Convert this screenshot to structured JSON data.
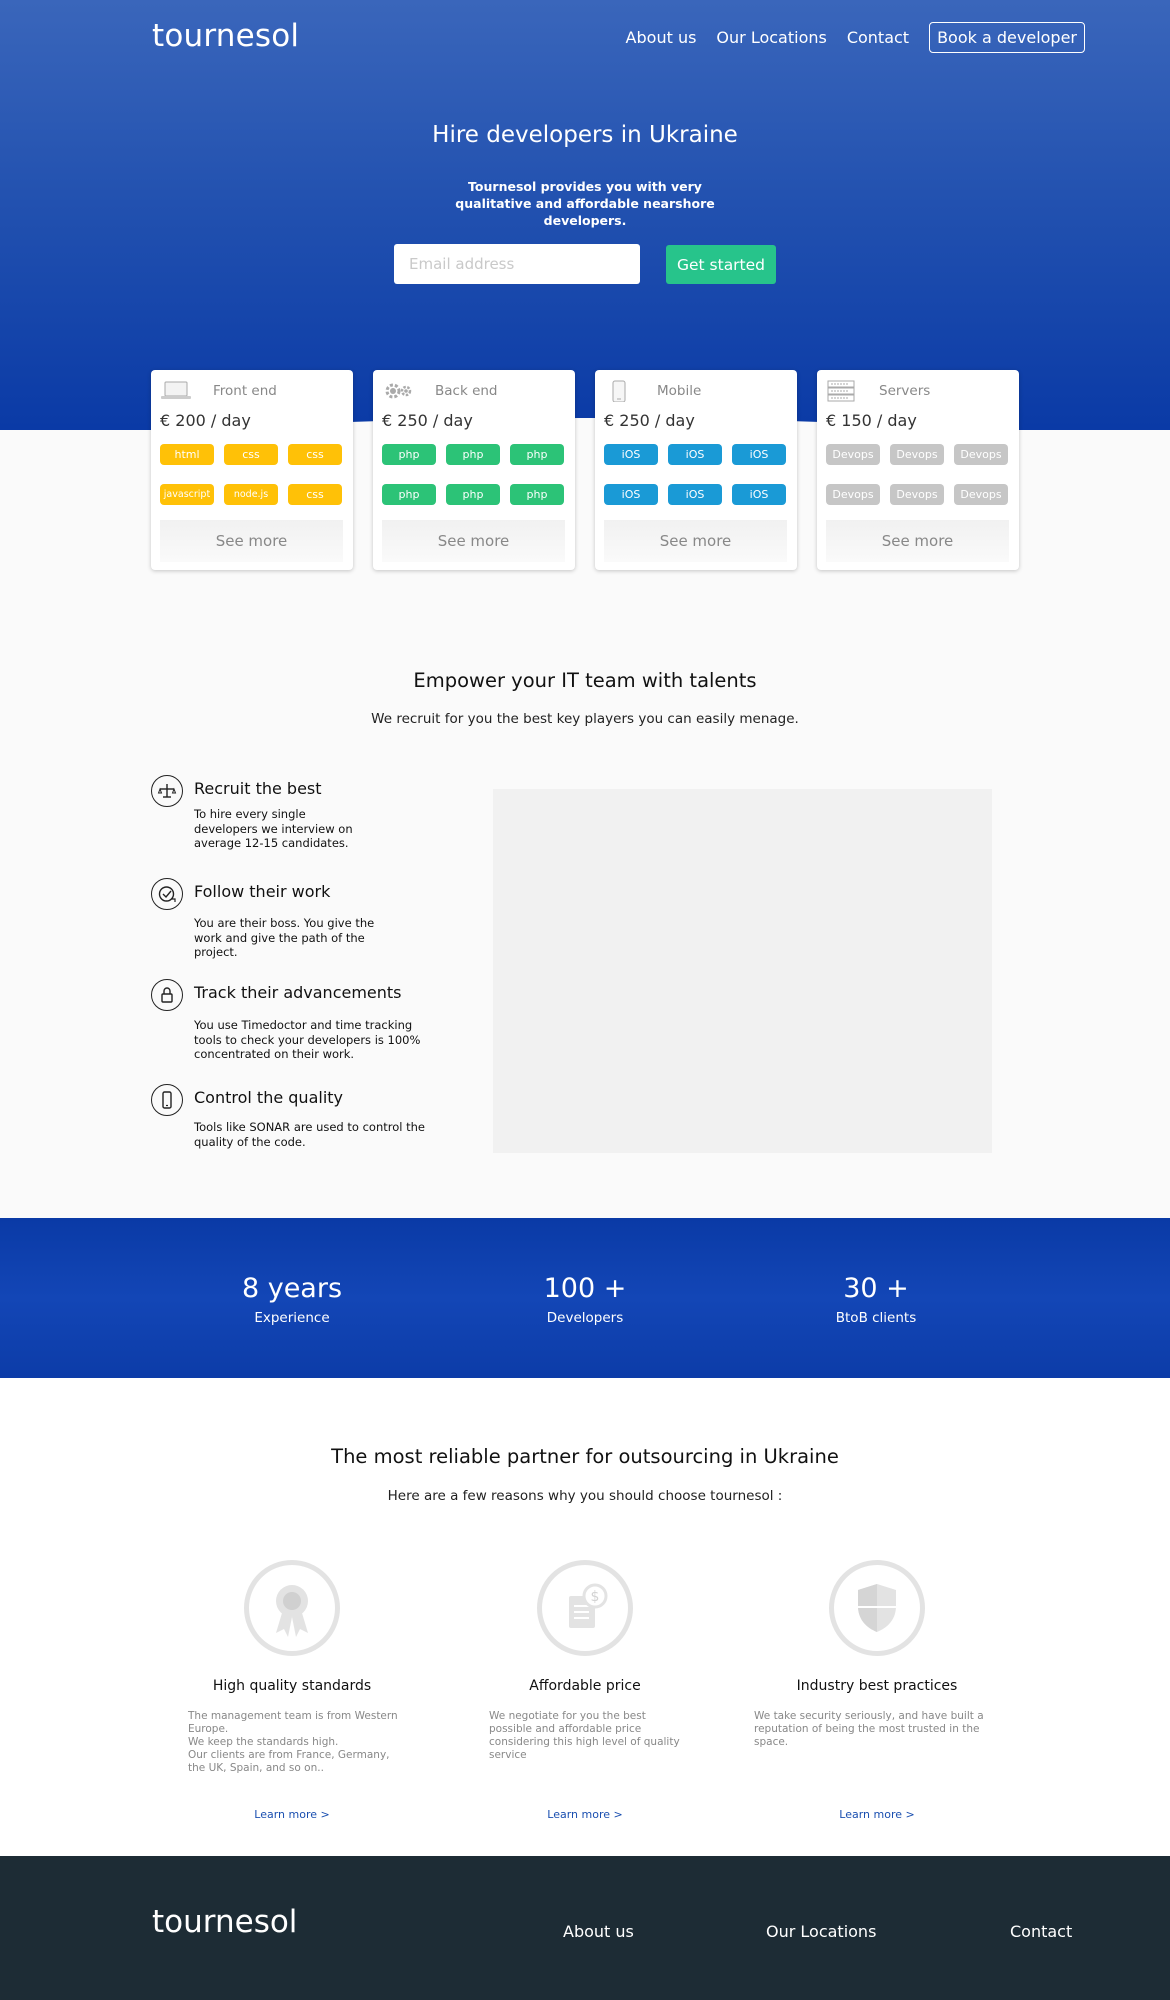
{
  "header": {
    "logo": "tournesol",
    "nav": [
      "About us",
      "Our Locations",
      "Contact"
    ],
    "book_label": "Book a developer"
  },
  "hero": {
    "title": "Hire developers in Ukraine",
    "subtitle": "Tournesol provides you with very qualitative and affordable nearshore developers.",
    "email_placeholder": "Email address",
    "cta_label": "Get started"
  },
  "cards": [
    {
      "title": "Front end",
      "price": "€ 200 / day",
      "icon": "laptop-icon",
      "tag_color": "#ffc107",
      "tags": [
        "html",
        "css",
        "css",
        "javascript",
        "node.js",
        "css"
      ],
      "see_more": "See more"
    },
    {
      "title": "Back end",
      "price": "€ 250 / day",
      "icon": "gears-icon",
      "tag_color": "#2cc377",
      "tags": [
        "php",
        "php",
        "php",
        "php",
        "php",
        "php"
      ],
      "see_more": "See more"
    },
    {
      "title": "Mobile",
      "price": "€ 250 / day",
      "icon": "smartphone-icon",
      "tag_color": "#1a9ad6",
      "tags": [
        "iOS",
        "iOS",
        "iOS",
        "iOS",
        "iOS",
        "iOS"
      ],
      "see_more": "See more"
    },
    {
      "title": "Servers",
      "price": "€ 150 / day",
      "icon": "server-icon",
      "tag_color": "#c6c6c6",
      "tags": [
        "Devops",
        "Devops",
        "Devops",
        "Devops",
        "Devops",
        "Devops"
      ],
      "see_more": "See more"
    }
  ],
  "empower": {
    "title": "Empower your IT team with talents",
    "subtitle": "We recruit for you the best key players you can easily menage.",
    "features": [
      {
        "icon": "balance-scale-icon",
        "title": "Recruit the best",
        "text": "To hire every single developers we interview on average 12-15 candidates."
      },
      {
        "icon": "clock-check-icon",
        "title": "Follow their work",
        "text": "You are their boss. You give the work and give the path of the project."
      },
      {
        "icon": "lock-icon",
        "title": "Track their advancements",
        "text": "You use Timedoctor and time tracking tools to check your developers is 100% concentrated on their work."
      },
      {
        "icon": "phone-icon",
        "title": "Control the quality",
        "text": "Tools like SONAR are used to control the quality of the code."
      }
    ]
  },
  "stats": [
    {
      "value": "8 years",
      "label": "Experience"
    },
    {
      "value": "100 +",
      "label": "Developers"
    },
    {
      "value": "30 +",
      "label": "BtoB clients"
    }
  ],
  "reasons": {
    "title": "The most reliable partner for outsourcing in Ukraine",
    "subtitle": "Here are a few reasons why you should choose tournesol :",
    "items": [
      {
        "icon": "award-ribbon-icon",
        "title": "High quality standards",
        "lines": [
          "The management team is from Western Europe.",
          "We keep the standards high.",
          "Our clients are from France, Germany, the UK, Spain, and so on.."
        ],
        "link": "Learn more >"
      },
      {
        "icon": "price-invoice-icon",
        "title": "Affordable price",
        "lines": [
          "We negotiate for you the best possible and affordable price considering this high level of quality service"
        ],
        "link": "Learn more >"
      },
      {
        "icon": "shield-icon",
        "title": "Industry best practices",
        "lines": [
          "We take security seriously, and have built a reputation of being the most trusted in the space."
        ],
        "link": "Learn more >"
      }
    ]
  },
  "footer": {
    "logo": "tournesol",
    "nav": [
      "About us",
      "Our Locations",
      "Contact"
    ]
  }
}
